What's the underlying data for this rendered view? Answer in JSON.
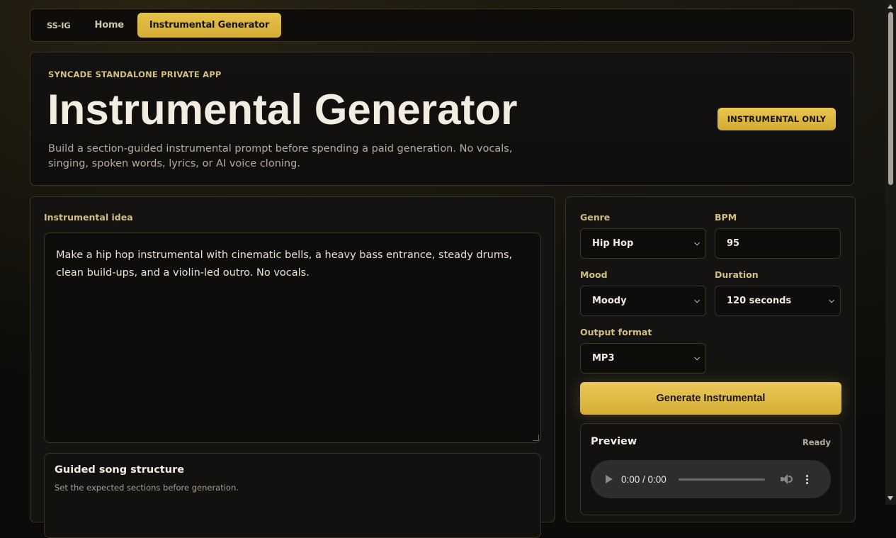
{
  "nav": {
    "brand": "SS-IG",
    "items": [
      "Home",
      "Instrumental Generator"
    ]
  },
  "hero": {
    "eyebrow": "SYNCADE STANDALONE PRIVATE APP",
    "title": "Instrumental Generator",
    "description": "Build a section-guided instrumental prompt before spending a paid generation. No vocals, singing, spoken words, lyrics, or AI voice cloning.",
    "badge": "INSTRUMENTAL ONLY"
  },
  "idea": {
    "label": "Instrumental idea",
    "value": "Make a hip hop instrumental with cinematic bells, a heavy bass entrance, steady drums, clean build-ups, and a violin-led outro. No vocals."
  },
  "structure": {
    "title": "Guided song structure",
    "subtitle": "Set the expected sections before generation."
  },
  "settings": {
    "genre": {
      "label": "Genre",
      "value": "Hip Hop"
    },
    "bpm": {
      "label": "BPM",
      "value": "95"
    },
    "mood": {
      "label": "Mood",
      "value": "Moody"
    },
    "duration": {
      "label": "Duration",
      "value": "120 seconds"
    },
    "format": {
      "label": "Output format",
      "value": "MP3"
    }
  },
  "generate_label": "Generate Instrumental",
  "preview": {
    "title": "Preview",
    "status": "Ready",
    "time": "0:00 / 0:00"
  },
  "colors": {
    "accent": "#d9b43f",
    "background": "#0c0b09",
    "panel_border": "#3a3424",
    "label": "#d4bf84"
  },
  "icons": [
    "chevron-down-icon",
    "play-icon",
    "volume-icon",
    "more-vertical-icon"
  ]
}
